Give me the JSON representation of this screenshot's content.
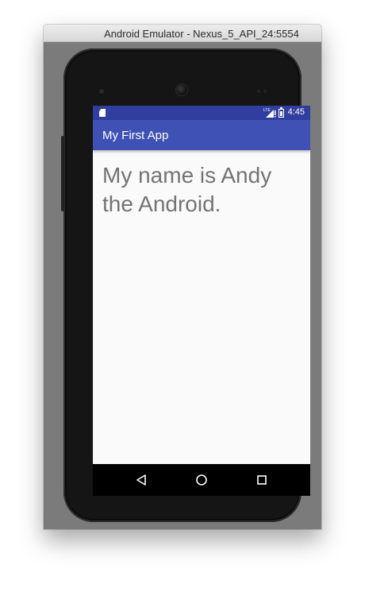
{
  "window": {
    "title": "Android Emulator - Nexus_5_API_24:5554"
  },
  "status_bar": {
    "time": "4:45",
    "network_label": "LTE",
    "background": "#303f9f"
  },
  "app_bar": {
    "title": "My First App",
    "background": "#3f51b5"
  },
  "content": {
    "message": "My name is Andy the Android."
  },
  "nav_bar": {
    "back_icon": "back-triangle-icon",
    "home_icon": "home-circle-icon",
    "recents_icon": "recents-square-icon"
  }
}
